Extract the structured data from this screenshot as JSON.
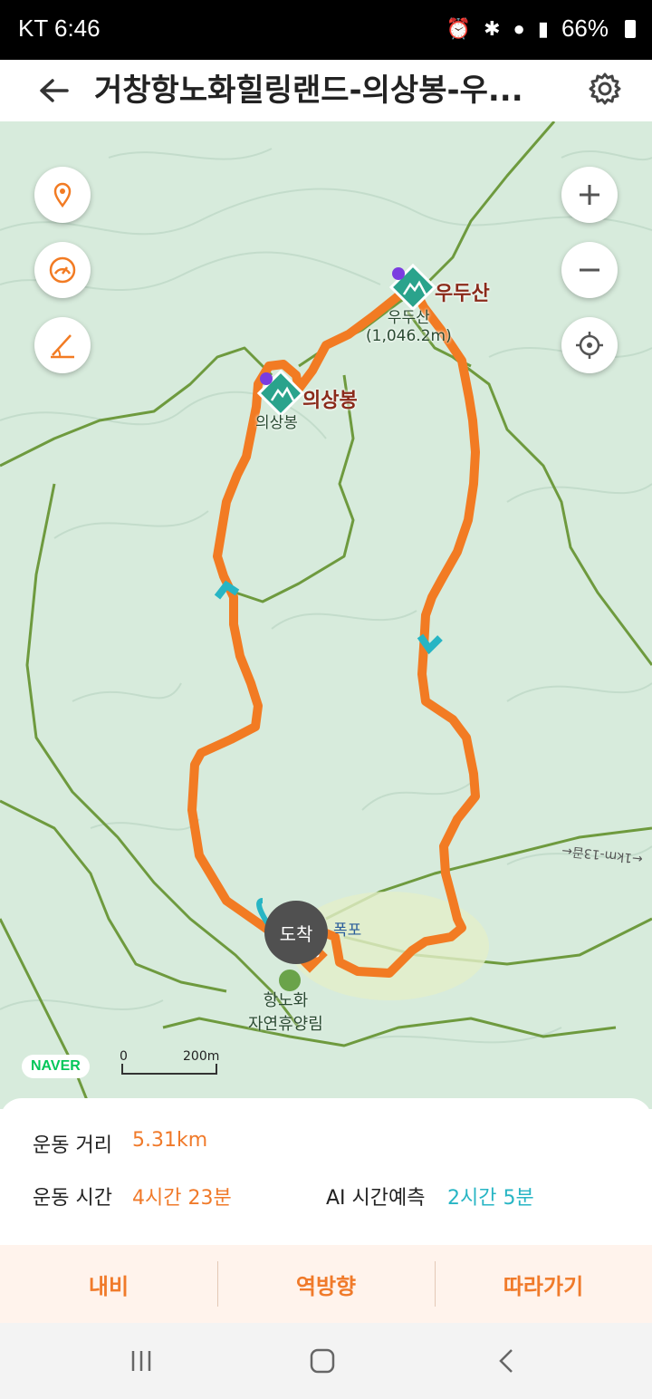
{
  "status": {
    "carrier_time": "KT 6:46",
    "battery": "66%"
  },
  "header": {
    "title": "거창항노화힐링랜드-의상봉-우..."
  },
  "map": {
    "peaks": [
      {
        "name": "우두산",
        "sub": "우두산\n(1,046.2m)"
      },
      {
        "name": "의상봉",
        "sub": "의상봉"
      }
    ],
    "waterfall": "폭포",
    "forest": "항노화\n자연휴양림",
    "road": "←1km-13곱←",
    "arrive": "도착",
    "naver": "NAVER",
    "scale": {
      "zero": "0",
      "dist": "200m"
    }
  },
  "stats": {
    "distance_label": "운동 거리",
    "distance": "5.31km",
    "time_label": "운동 시간",
    "time": "4시간 23분",
    "ai_label": "AI 시간예측",
    "ai_time": "2시간 5분"
  },
  "actions": {
    "nav": "내비",
    "reverse": "역방향",
    "follow": "따라가기"
  },
  "colors": {
    "route": "#f27b23",
    "accent_teal": "#27b5c4",
    "peak_marker": "#2aa38c"
  }
}
